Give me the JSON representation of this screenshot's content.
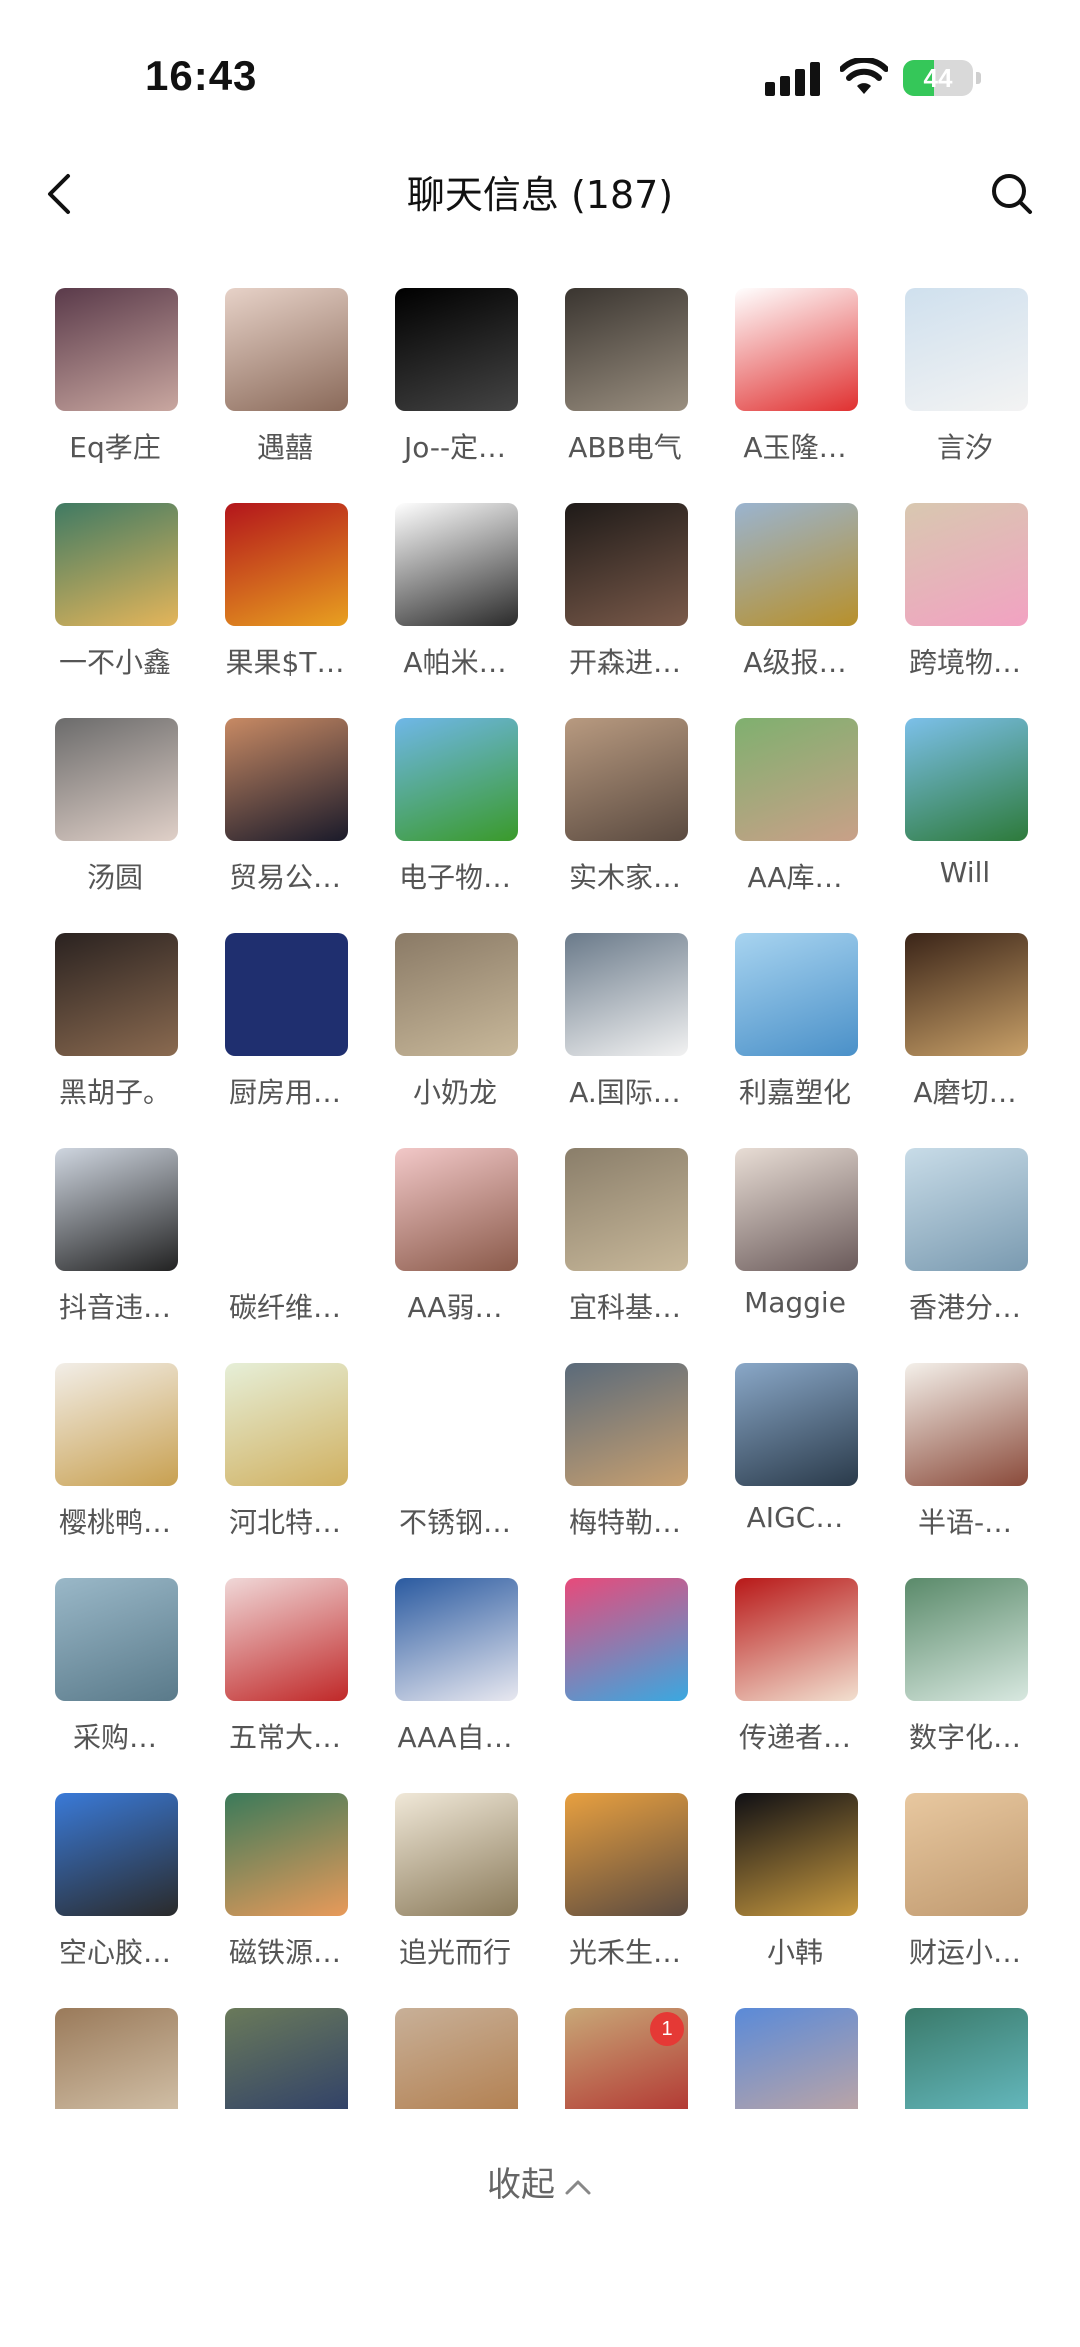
{
  "status_bar": {
    "time": "16:43",
    "battery": "44",
    "battery_level": 0.44
  },
  "nav": {
    "title": "聊天信息 (187)"
  },
  "members": [
    {
      "name": "Eq孝庄",
      "colors": [
        "#5a3a4a",
        "#c9a7a0"
      ]
    },
    {
      "name": "遇囍",
      "colors": [
        "#e7d2c8",
        "#8a6a5a"
      ]
    },
    {
      "name": "Jo--定…",
      "colors": [
        "#000000",
        "#444444"
      ]
    },
    {
      "name": "ABB电气",
      "colors": [
        "#3a3530",
        "#9a8f80"
      ]
    },
    {
      "name": "A玉隆…",
      "colors": [
        "#ffffff",
        "#e03030"
      ]
    },
    {
      "name": "言汐",
      "colors": [
        "#cfe0ee",
        "#f3f3f3"
      ]
    },
    {
      "name": "一不小鑫",
      "colors": [
        "#3f7a63",
        "#e4b55a"
      ]
    },
    {
      "name": "果果$T…",
      "colors": [
        "#b3151b",
        "#e8a020"
      ]
    },
    {
      "name": "A帕米…",
      "colors": [
        "#ffffff",
        "#2a2a2a"
      ]
    },
    {
      "name": "开森进…",
      "colors": [
        "#1e1a18",
        "#7a5a4a"
      ]
    },
    {
      "name": "A级报…",
      "colors": [
        "#9ab4d0",
        "#b8902a"
      ]
    },
    {
      "name": "跨境物…",
      "colors": [
        "#d8c8b0",
        "#f2a2c2"
      ]
    },
    {
      "name": "汤圆",
      "colors": [
        "#6b6b6b",
        "#e0d0c8"
      ]
    },
    {
      "name": "贸易公…",
      "colors": [
        "#c88a64",
        "#1a1a2a"
      ]
    },
    {
      "name": "电子物…",
      "colors": [
        "#6fb7e8",
        "#3a9a2a"
      ]
    },
    {
      "name": "实木家…",
      "colors": [
        "#b89a80",
        "#5a4a40"
      ]
    },
    {
      "name": "AA库…",
      "colors": [
        "#7fb06f",
        "#c9a088"
      ]
    },
    {
      "name": "Will",
      "colors": [
        "#7cc0ea",
        "#2d7a3a"
      ]
    },
    {
      "name": "黑胡子。",
      "colors": [
        "#2a2220",
        "#8a6a50"
      ]
    },
    {
      "name": "厨房用…",
      "colors": [
        "#1f2f6f",
        "#1f2f6f"
      ]
    },
    {
      "name": "小奶龙",
      "colors": [
        "#8a7a66",
        "#c8b89a"
      ]
    },
    {
      "name": "A.国际…",
      "colors": [
        "#6a7a8a",
        "#f2f2f2"
      ]
    },
    {
      "name": "利嘉塑化",
      "colors": [
        "#a8d4f0",
        "#4a90c8"
      ]
    },
    {
      "name": "A磨切…",
      "colors": [
        "#3a2418",
        "#c8a068"
      ]
    },
    {
      "name": "抖音违…",
      "colors": [
        "#cfd6e0",
        "#222222"
      ]
    },
    {
      "name": "碳纤维…",
      "colors": [
        "#ffffff",
        "#ffffff"
      ]
    },
    {
      "name": "AA弱…",
      "colors": [
        "#f2c8c8",
        "#8a5a4a"
      ]
    },
    {
      "name": "宜科基…",
      "colors": [
        "#8a7e6a",
        "#c8b89a"
      ]
    },
    {
      "name": "Maggie",
      "colors": [
        "#e8ddd5",
        "#6a5a5a"
      ]
    },
    {
      "name": "香港分…",
      "colors": [
        "#c8dce8",
        "#7a9ab0"
      ]
    },
    {
      "name": "樱桃鸭…",
      "colors": [
        "#f2eee8",
        "#c8a050"
      ]
    },
    {
      "name": "河北特…",
      "colors": [
        "#e6efd8",
        "#d0b060"
      ]
    },
    {
      "name": "不锈钢…",
      "colors": [
        "#ffffff",
        "#ffffff"
      ]
    },
    {
      "name": "梅特勒…",
      "colors": [
        "#5a6a7a",
        "#c8a070"
      ]
    },
    {
      "name": "AIGC…",
      "colors": [
        "#8aa8c8",
        "#2a3a4a"
      ]
    },
    {
      "name": "半语-…",
      "colors": [
        "#f4f0ea",
        "#8a4a3a"
      ]
    },
    {
      "name": "采购…",
      "colors": [
        "#9ab8c8",
        "#5a7a8a"
      ]
    },
    {
      "name": "五常大…",
      "colors": [
        "#f0d8d8",
        "#c02828"
      ]
    },
    {
      "name": "AAA自…",
      "colors": [
        "#2a5aa0",
        "#e8e8f0"
      ]
    },
    {
      "name": "",
      "colors": [
        "#e84a7a",
        "#3aa8e0"
      ]
    },
    {
      "name": "传递者…",
      "colors": [
        "#b81818",
        "#f2e0d0"
      ]
    },
    {
      "name": "数字化…",
      "colors": [
        "#5a8a6a",
        "#d8e8e0"
      ]
    },
    {
      "name": "空心胶…",
      "colors": [
        "#3a7ad8",
        "#2a2a2a"
      ]
    },
    {
      "name": "磁铁源…",
      "colors": [
        "#3a7a5a",
        "#e89a5a"
      ]
    },
    {
      "name": "追光而行",
      "colors": [
        "#f0e8d8",
        "#8a7a5a"
      ]
    },
    {
      "name": "光禾生…",
      "colors": [
        "#e8a040",
        "#5a4a40"
      ]
    },
    {
      "name": "小韩",
      "colors": [
        "#0f0f14",
        "#c89a40"
      ]
    },
    {
      "name": "财运小…",
      "colors": [
        "#e8c8a0",
        "#c09a70"
      ]
    },
    {
      "name": "",
      "colors": [
        "#9a7a5a",
        "#d8c8b0"
      ]
    },
    {
      "name": "",
      "colors": [
        "#6a7a5a",
        "#2a3a6a"
      ]
    },
    {
      "name": "",
      "colors": [
        "#c8b098",
        "#b07a48"
      ]
    },
    {
      "name": "",
      "colors": [
        "#c8a878",
        "#b02a2a"
      ],
      "badge": "1"
    },
    {
      "name": "",
      "colors": [
        "#5a8ad8",
        "#c8a8a0"
      ]
    },
    {
      "name": "",
      "colors": [
        "#3a7a6a",
        "#6ac0c8"
      ]
    }
  ],
  "collapse": {
    "label": "收起"
  }
}
